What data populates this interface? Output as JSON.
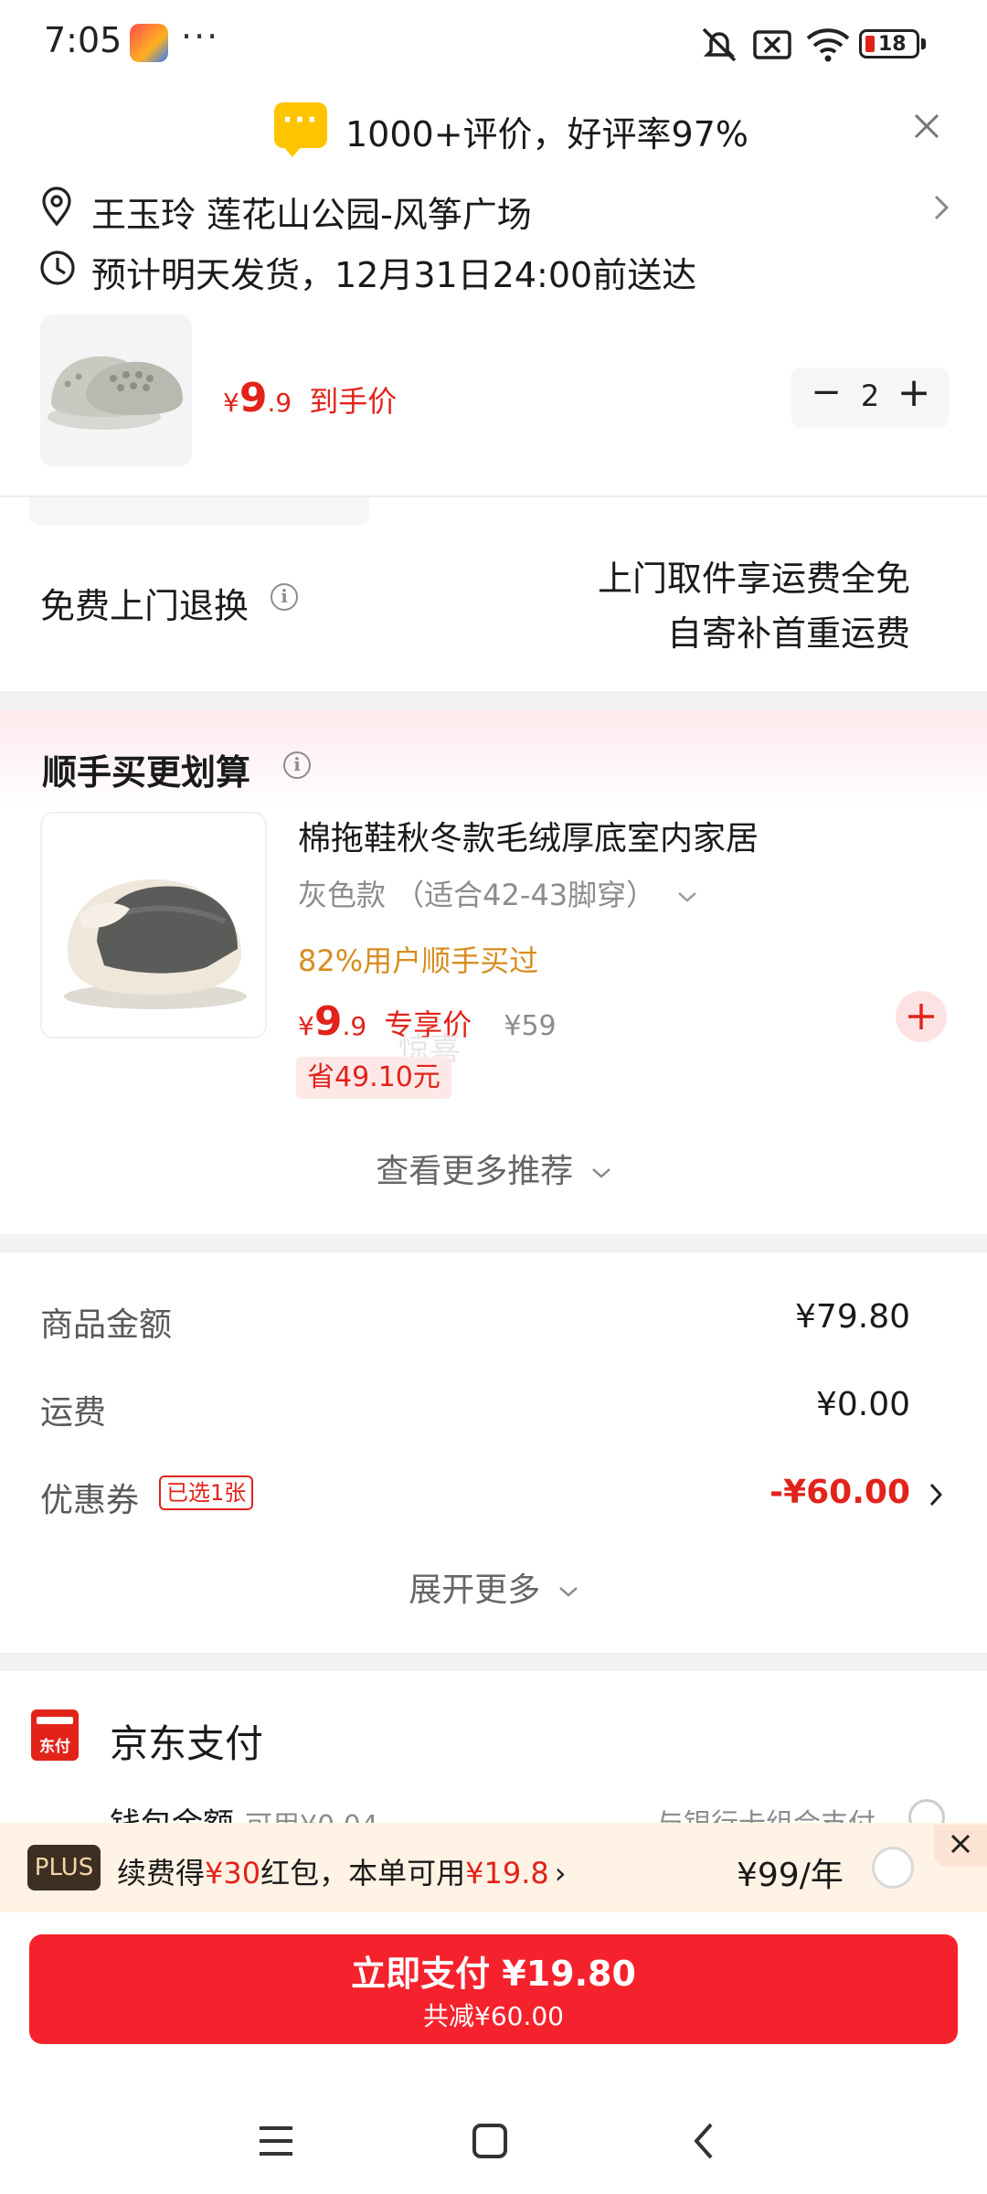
{
  "status_bar": {
    "time": "7:05",
    "dots": "···",
    "battery": "18"
  },
  "banner": {
    "icon_text": "···",
    "text": "1000+评价，好评率97%"
  },
  "address": {
    "name_place": "王玉玲  莲花山公园-风筝广场"
  },
  "delivery": {
    "text": "预计明天发货，12月31日24:00前送达"
  },
  "product": {
    "currency": "¥",
    "price_int": "9",
    "price_dec": ".9",
    "price_label": "到手价",
    "quantity": "2",
    "minus": "−",
    "plus": "+"
  },
  "return": {
    "label": "免费上门退换",
    "line1": "上门取件享运费全免",
    "line2": "自寄补首重运费"
  },
  "recommend": {
    "section_title": "顺手买更划算",
    "item": {
      "title": "棉拖鞋秋冬款毛绒厚底室内家居",
      "variant": "灰色款 （适合42-43脚穿）",
      "stat": "82%用户顺手买过",
      "currency": "¥",
      "price_int": "9",
      "price_dec": ".9",
      "price_label": "专享价",
      "original_price": "¥59",
      "save": "省49.10元",
      "watermark": "惊喜"
    },
    "more": "查看更多推荐"
  },
  "summary": {
    "goods_label": "商品金额",
    "goods_value": "¥79.80",
    "shipping_label": "运费",
    "shipping_value": "¥0.00",
    "coupon_label": "优惠券",
    "coupon_tag": "已选1张",
    "coupon_value": "-¥60.00",
    "expand": "展开更多"
  },
  "payment": {
    "logo_text": "东付",
    "title": "京东支付",
    "wallet": "钱包余额",
    "wallet_avail": "可用¥0.04",
    "combo": "与银行卡组合支付"
  },
  "plus": {
    "badge": "PLUS",
    "text_a": "续费得",
    "text_b": "¥30",
    "text_c": "红包，本单可用",
    "text_d": "¥19.8",
    "arrow": "›",
    "price": "¥99/年"
  },
  "pay_button": {
    "label": "立即支付 ¥19.80",
    "sub": "共减¥60.00"
  },
  "colors": {
    "accent": "#e2231a",
    "button": "#f5222d",
    "plus_bg": "#fff3e5"
  }
}
